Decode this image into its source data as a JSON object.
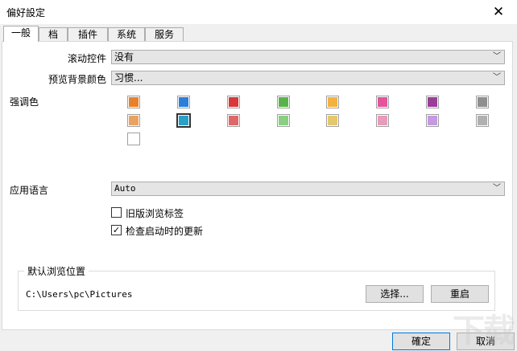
{
  "window": {
    "title": "偏好設定",
    "close_glyph": "✕"
  },
  "tabs": [
    {
      "label": "一般"
    },
    {
      "label": "档"
    },
    {
      "label": "插件"
    },
    {
      "label": "系统"
    },
    {
      "label": "服务"
    }
  ],
  "general": {
    "scroll_control": {
      "label": "滚动控件",
      "value": "没有"
    },
    "preview_bg": {
      "label": "预览背景颜色",
      "value": "习惯..."
    },
    "accent": {
      "label": "强调色",
      "row1": [
        "#e8822a",
        "#2b7fd8",
        "#d9383a",
        "#58b44a",
        "#f2b140",
        "#e3549b",
        "#9a3e98",
        "#8f8f8f"
      ],
      "row2": [
        "#eba261",
        "#2ba0c8",
        "#e06768",
        "#88cf80",
        "#e5c76d",
        "#e89bbb",
        "#c49ae0",
        "#b0b0b0"
      ],
      "row3": [
        "#ffffff"
      ]
    },
    "language": {
      "label": "应用语言",
      "value": "Auto"
    },
    "legacy_tabs": {
      "label": "旧版浏览标签",
      "checked": false,
      "mark": ""
    },
    "check_updates": {
      "label": "检查启动时的更新",
      "checked": true,
      "mark": "✓"
    }
  },
  "browse_location": {
    "title": "默认浏览位置",
    "path": "C:\\Users\\pc\\Pictures",
    "choose_label": "选择...",
    "reset_label": "重启"
  },
  "footer": {
    "ok_label": "確定",
    "cancel_label": "取消"
  },
  "watermark": "下载"
}
